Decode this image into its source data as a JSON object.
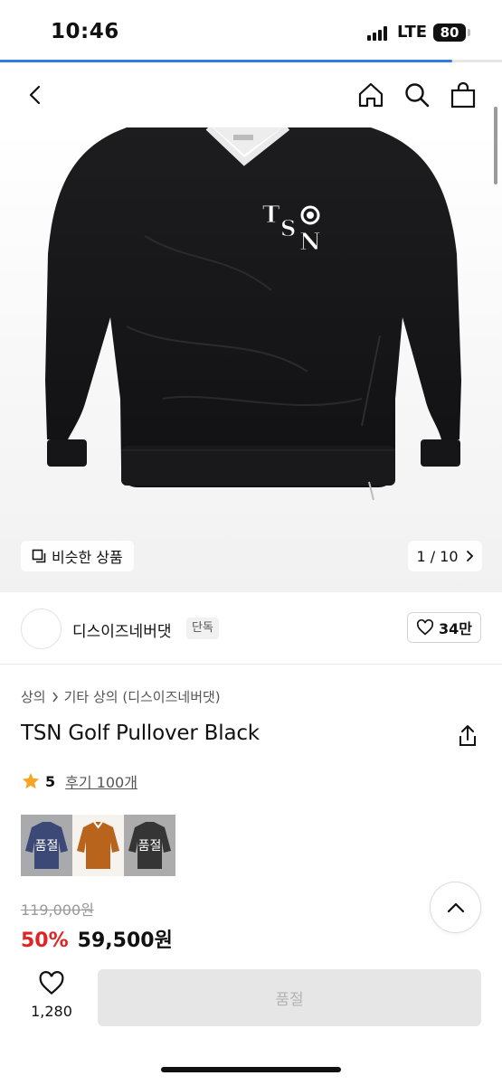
{
  "status_bar": {
    "time": "10:46",
    "network": "LTE",
    "battery": "80"
  },
  "page_progress": 0.9,
  "colors": {
    "accent_blue": "#2f7de1",
    "sale_red": "#e02424",
    "star": "#f5a623"
  },
  "gallery": {
    "similar_label": "비슷한 상품",
    "counter": "1 / 10"
  },
  "seller": {
    "name": "디스이즈네버댓",
    "badge": "단독",
    "likes": "34만"
  },
  "breadcrumb": {
    "category": "상의",
    "subcategory": "기타 상의 (디스이즈네버댓)"
  },
  "product": {
    "title": "TSN Golf Pullover Black",
    "rating": "5",
    "reviews": "후기 100개"
  },
  "colors_options": [
    {
      "name": "navy",
      "status": "품절"
    },
    {
      "name": "brown",
      "status": ""
    },
    {
      "name": "black",
      "status": "품절"
    }
  ],
  "pricing": {
    "original": "119,000원",
    "discount": "50%",
    "sale": "59,500원"
  },
  "bottom_bar": {
    "like_count": "1,280",
    "buy_label": "품절"
  },
  "icons": [
    "back-icon",
    "home-icon",
    "search-icon",
    "bag-icon",
    "copy-icon",
    "chevron-right-icon",
    "heart-icon",
    "share-icon",
    "star-icon",
    "chevron-up-icon"
  ]
}
